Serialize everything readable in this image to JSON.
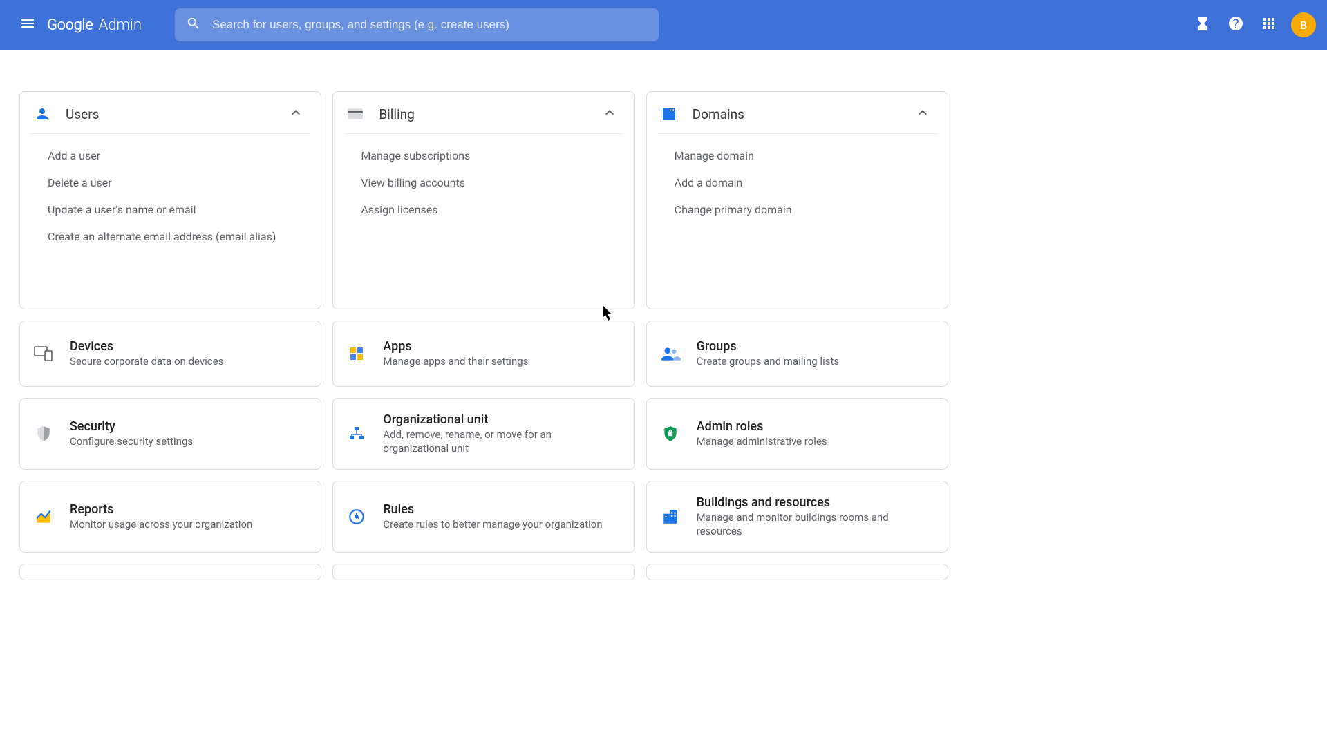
{
  "header": {
    "logo_google": "Google",
    "logo_admin": "Admin",
    "search_placeholder": "Search for users, groups, and settings (e.g. create users)",
    "avatar_letter": "B"
  },
  "expanded_cards": [
    {
      "id": "users",
      "title": "Users",
      "icon": "person-icon",
      "links": [
        "Add a user",
        "Delete a user",
        "Update a user's name or email",
        "Create an alternate email address (email alias)"
      ]
    },
    {
      "id": "billing",
      "title": "Billing",
      "icon": "credit-card-icon",
      "links": [
        "Manage subscriptions",
        "View billing accounts",
        "Assign licenses"
      ]
    },
    {
      "id": "domains",
      "title": "Domains",
      "icon": "domain-icon",
      "links": [
        "Manage domain",
        "Add a domain",
        "Change primary domain"
      ]
    }
  ],
  "small_cards": [
    {
      "id": "devices",
      "title": "Devices",
      "desc": "Secure corporate data on devices",
      "icon": "devices-icon"
    },
    {
      "id": "apps",
      "title": "Apps",
      "desc": "Manage apps and their settings",
      "icon": "apps-icon"
    },
    {
      "id": "groups",
      "title": "Groups",
      "desc": "Create groups and mailing lists",
      "icon": "groups-icon"
    },
    {
      "id": "security",
      "title": "Security",
      "desc": "Configure security settings",
      "icon": "shield-icon"
    },
    {
      "id": "orgunit",
      "title": "Organizational unit",
      "desc": "Add, remove, rename, or move for an organizational unit",
      "icon": "org-unit-icon"
    },
    {
      "id": "adminroles",
      "title": "Admin roles",
      "desc": "Manage administrative roles",
      "icon": "admin-roles-icon"
    },
    {
      "id": "reports",
      "title": "Reports",
      "desc": "Monitor usage across your organization",
      "icon": "reports-icon"
    },
    {
      "id": "rules",
      "title": "Rules",
      "desc": "Create rules to better manage your organization",
      "icon": "rules-icon"
    },
    {
      "id": "buildings",
      "title": "Buildings and resources",
      "desc": "Manage and monitor buildings rooms and resources",
      "icon": "buildings-icon"
    }
  ],
  "partial_row_count": 3
}
